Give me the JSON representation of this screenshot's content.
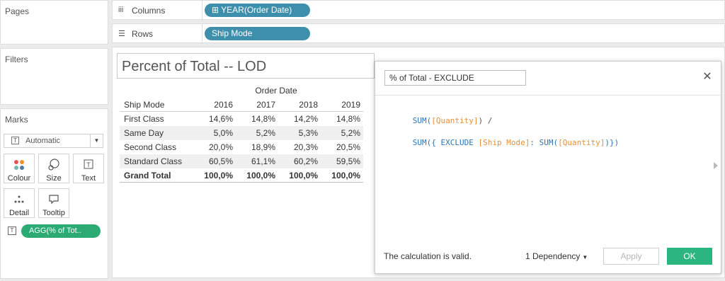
{
  "left_panels": {
    "pages_title": "Pages",
    "filters_title": "Filters",
    "marks_title": "Marks",
    "mark_type": "Automatic",
    "mark_type_icon": "T",
    "mark_buttons": [
      {
        "label": "Colour",
        "icon": "colour-icon"
      },
      {
        "label": "Size",
        "icon": "size-icon"
      },
      {
        "label": "Text",
        "icon": "text-icon"
      },
      {
        "label": "Detail",
        "icon": "detail-icon"
      },
      {
        "label": "Tooltip",
        "icon": "tooltip-icon"
      }
    ],
    "marks_pill": "AGG(% of Tot..",
    "marks_pill_icon": "T"
  },
  "shelves": {
    "columns_label": "Columns",
    "columns_pill": "⊞ YEAR(Order Date)",
    "rows_label": "Rows",
    "rows_pill": "Ship Mode"
  },
  "view": {
    "title": "Percent of Total -- LOD",
    "column_group_header": "Order Date",
    "row_header": "Ship Mode",
    "years": [
      "2016",
      "2017",
      "2018",
      "2019"
    ],
    "rows": [
      {
        "label": "First Class",
        "values": [
          "14,6%",
          "14,8%",
          "14,2%",
          "14,8%"
        ]
      },
      {
        "label": "Same Day",
        "values": [
          "5,0%",
          "5,2%",
          "5,3%",
          "5,2%"
        ]
      },
      {
        "label": "Second Class",
        "values": [
          "20,0%",
          "18,9%",
          "20,3%",
          "20,5%"
        ]
      },
      {
        "label": "Standard Class",
        "values": [
          "60,5%",
          "61,1%",
          "60,2%",
          "59,5%"
        ]
      }
    ],
    "grand_total": {
      "label": "Grand Total",
      "values": [
        "100,0%",
        "100,0%",
        "100,0%",
        "100,0%"
      ]
    }
  },
  "calc_dialog": {
    "name": "% of Total - EXCLUDE",
    "close_icon": "✕",
    "code_lines": [
      [
        {
          "t": "SUM(",
          "c": "kw"
        },
        {
          "t": "[Quantity]",
          "c": "fld"
        },
        {
          "t": ") /",
          "c": "op"
        }
      ],
      [
        {
          "t": "SUM(",
          "c": "kw"
        },
        {
          "t": "{ EXCLUDE ",
          "c": "kw"
        },
        {
          "t": "[Ship Mode]",
          "c": "dim"
        },
        {
          "t": ": SUM(",
          "c": "kw"
        },
        {
          "t": "[Quantity]",
          "c": "fld"
        },
        {
          "t": ")})",
          "c": "kw"
        }
      ]
    ],
    "status": "The calculation is valid.",
    "dependency": "1 Dependency",
    "apply_label": "Apply",
    "ok_label": "OK"
  }
}
